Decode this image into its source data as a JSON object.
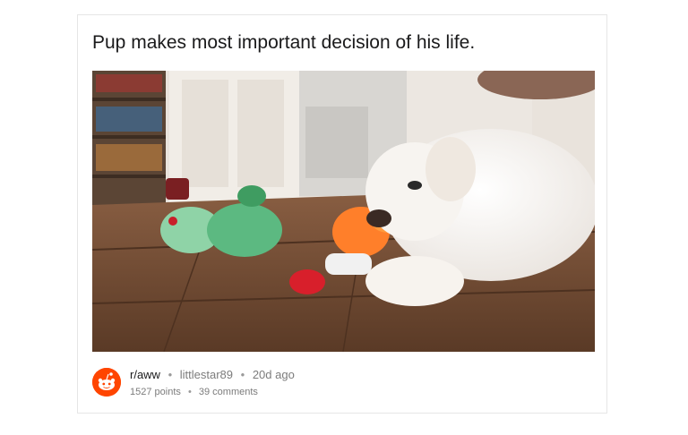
{
  "post": {
    "title": "Pup makes most important decision of his life.",
    "subreddit": "r/aww",
    "author": "littlestar89",
    "age": "20d ago",
    "points": "1527 points",
    "comments": "39 comments"
  },
  "icons": {
    "subreddit": "reddit-alien-icon",
    "separator": "bullet"
  },
  "colors": {
    "reddit_orange": "#ff4500",
    "title_text": "#1a1a1b",
    "meta_text": "#7c7c7c",
    "card_border": "#e6e6e6"
  }
}
